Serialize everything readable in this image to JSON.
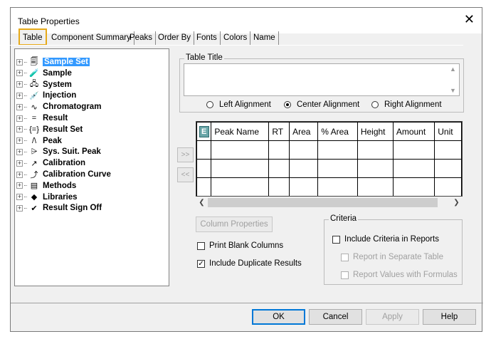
{
  "window": {
    "title": "Table Properties"
  },
  "tabs": [
    {
      "label": "Table",
      "active": true
    },
    {
      "label": "Component Summary"
    },
    {
      "label": "Peaks"
    },
    {
      "label": "Order By"
    },
    {
      "label": "Fonts"
    },
    {
      "label": "Colors"
    },
    {
      "label": "Name"
    }
  ],
  "tree": [
    {
      "label": "Sample Set",
      "icon": "sample-set-icon",
      "glyph": "🗐",
      "selected": true
    },
    {
      "label": "Sample",
      "icon": "vial-icon",
      "glyph": "🧪"
    },
    {
      "label": "System",
      "icon": "system-icon",
      "glyph": "🖧"
    },
    {
      "label": "Injection",
      "icon": "syringe-icon",
      "glyph": "💉"
    },
    {
      "label": "Chromatogram",
      "icon": "chromatogram-icon",
      "glyph": "∿"
    },
    {
      "label": "Result",
      "icon": "result-icon",
      "glyph": "="
    },
    {
      "label": "Result Set",
      "icon": "result-set-icon",
      "glyph": "{=}"
    },
    {
      "label": "Peak",
      "icon": "peak-icon",
      "glyph": "/\\"
    },
    {
      "label": "Sys. Suit. Peak",
      "icon": "sys-suit-peak-icon",
      "glyph": "⩥"
    },
    {
      "label": "Calibration",
      "icon": "calibration-icon",
      "glyph": "↗"
    },
    {
      "label": "Calibration Curve",
      "icon": "calibration-curve-icon",
      "glyph": "⤴"
    },
    {
      "label": "Methods",
      "icon": "methods-icon",
      "glyph": "▤"
    },
    {
      "label": "Libraries",
      "icon": "libraries-icon",
      "glyph": "◆"
    },
    {
      "label": "Result Sign Off",
      "icon": "sign-off-icon",
      "glyph": "✔"
    }
  ],
  "table_title": {
    "legend": "Table Title",
    "value": "",
    "alignment": {
      "options": [
        "Left Alignment",
        "Center Alignment",
        "Right Alignment"
      ],
      "selected": "Center Alignment"
    }
  },
  "grid": {
    "columns": [
      "Peak Name",
      "RT",
      "Area",
      "% Area",
      "Height",
      "Amount",
      "Unit"
    ],
    "rows": 3
  },
  "side_buttons": {
    "add": ">>",
    "remove": "<<"
  },
  "column_properties_label": "Column Properties",
  "options": {
    "print_blank_columns": {
      "label": "Print Blank Columns",
      "checked": false
    },
    "include_duplicate_results": {
      "label": "Include Duplicate Results",
      "checked": true
    }
  },
  "criteria": {
    "legend": "Criteria",
    "include_in_reports": {
      "label": "Include Criteria in Reports",
      "checked": false
    },
    "separate_table": {
      "label": "Report in Separate Table",
      "checked": false
    },
    "with_formulas": {
      "label": "Report Values with Formulas",
      "checked": false
    }
  },
  "footer": {
    "ok": "OK",
    "cancel": "Cancel",
    "apply": "Apply",
    "help": "Help"
  }
}
